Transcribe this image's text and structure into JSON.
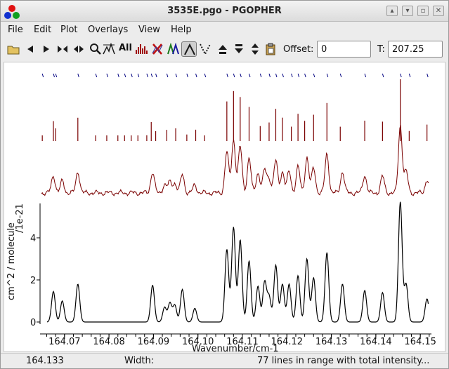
{
  "window": {
    "title": "3535E.pgo - PGOPHER",
    "controls": [
      "up-icon",
      "down-icon",
      "restore-icon",
      "close-icon"
    ]
  },
  "menu": [
    "File",
    "Edit",
    "Plot",
    "Overlays",
    "View",
    "Help"
  ],
  "toolbar": {
    "all_label": "All",
    "offset_label": "Offset:",
    "offset_value": "0",
    "temp_label": "T:",
    "temp_value": "207.25"
  },
  "plot": {
    "y_axis_label": "cm^2 / molecule",
    "y_axis_scale": "/1e-21",
    "x_axis_label": "Wavenumber/cm-1",
    "y_ticks": [
      "0",
      "2",
      "4"
    ],
    "x_ticks": [
      "164.07",
      "164.08",
      "164.09",
      "164.10",
      "164.11",
      "164.12",
      "164.13",
      "164.14",
      "164.15"
    ],
    "colors": {
      "simulated": "#000000",
      "observed": "#7a0000",
      "stick": "#7a0000",
      "marker": "#000080"
    }
  },
  "chart_data": {
    "type": "line",
    "xlabel": "Wavenumber/cm-1",
    "ylabel": "cm^2 / molecule",
    "xlim": [
      164.0645,
      164.1525
    ],
    "ylim": [
      0,
      5.8
    ],
    "series": [],
    "stick_positions": [
      164.065,
      164.0675,
      164.068,
      164.073,
      164.077,
      164.0795,
      164.082,
      164.0835,
      164.085,
      164.0865,
      164.0885,
      164.0895,
      164.0905,
      164.093,
      164.095,
      164.0975,
      164.0995,
      164.1015,
      164.1065,
      164.108,
      164.1095,
      164.1115,
      164.114,
      164.116,
      164.1175,
      164.119,
      164.121,
      164.1225,
      164.124,
      164.126,
      164.129,
      164.132,
      164.1375,
      164.1415,
      164.1455,
      164.1475,
      164.1515
    ],
    "peaks": [
      {
        "x": 164.0675,
        "y": 1.45
      },
      {
        "x": 164.0695,
        "y": 1.0
      },
      {
        "x": 164.073,
        "y": 1.8
      },
      {
        "x": 164.0898,
        "y": 1.75
      },
      {
        "x": 164.0925,
        "y": 0.7
      },
      {
        "x": 164.0937,
        "y": 0.9
      },
      {
        "x": 164.0948,
        "y": 0.8
      },
      {
        "x": 164.0965,
        "y": 1.55
      },
      {
        "x": 164.0993,
        "y": 0.65
      },
      {
        "x": 164.1065,
        "y": 3.45
      },
      {
        "x": 164.108,
        "y": 4.5
      },
      {
        "x": 164.1095,
        "y": 3.9
      },
      {
        "x": 164.1115,
        "y": 2.9
      },
      {
        "x": 164.1135,
        "y": 1.7
      },
      {
        "x": 164.115,
        "y": 1.9
      },
      {
        "x": 164.116,
        "y": 1.2
      },
      {
        "x": 164.1175,
        "y": 2.7
      },
      {
        "x": 164.119,
        "y": 1.8
      },
      {
        "x": 164.1205,
        "y": 1.8
      },
      {
        "x": 164.1225,
        "y": 2.2
      },
      {
        "x": 164.1245,
        "y": 3.0
      },
      {
        "x": 164.126,
        "y": 2.1
      },
      {
        "x": 164.129,
        "y": 3.3
      },
      {
        "x": 164.1325,
        "y": 1.8
      },
      {
        "x": 164.1375,
        "y": 1.5
      },
      {
        "x": 164.1415,
        "y": 1.4
      },
      {
        "x": 164.1455,
        "y": 5.7
      },
      {
        "x": 164.1468,
        "y": 1.8
      },
      {
        "x": 164.1515,
        "y": 1.1
      }
    ]
  },
  "status": {
    "cursor_value": "164.133",
    "width_label": "Width:",
    "message": "77 lines in range with total intensity..."
  }
}
